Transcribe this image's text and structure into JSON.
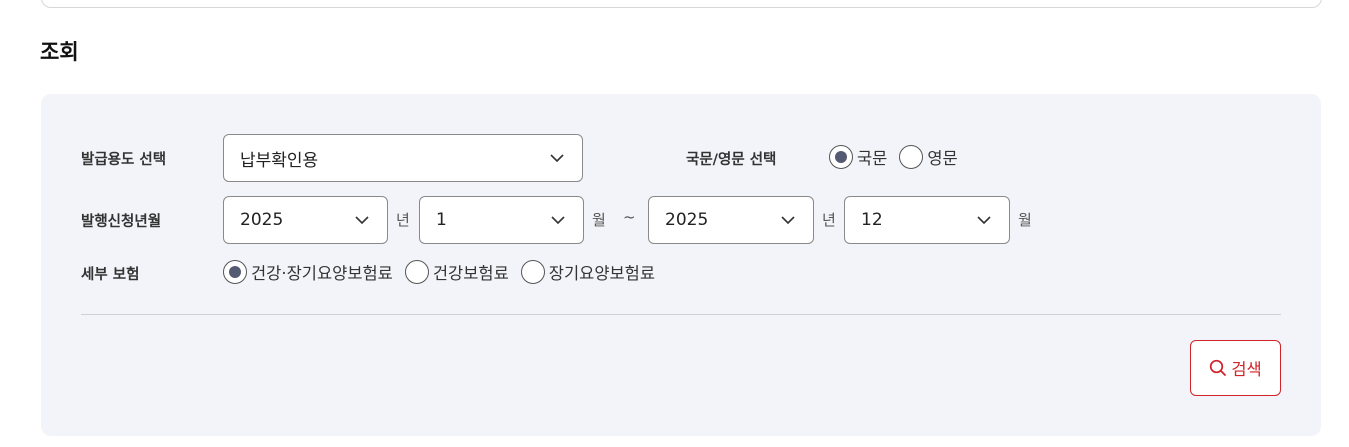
{
  "section_title": "조회",
  "purpose": {
    "label": "발급용도 선택",
    "selected": "납부확인용"
  },
  "language": {
    "label": "국문/영문 선택",
    "options": [
      {
        "label": "국문",
        "checked": true
      },
      {
        "label": "영문",
        "checked": false
      }
    ]
  },
  "period": {
    "label": "발행신청년월",
    "start_year": "2025",
    "start_month": "1",
    "end_year": "2025",
    "end_month": "12",
    "year_unit": "년",
    "month_unit": "월",
    "separator": "~"
  },
  "insurance": {
    "label": "세부 보험",
    "options": [
      {
        "label": "건강·장기요양보험료",
        "checked": true
      },
      {
        "label": "건강보험료",
        "checked": false
      },
      {
        "label": "장기요양보험료",
        "checked": false
      }
    ]
  },
  "search_button": {
    "label": "검색"
  },
  "colors": {
    "panel_bg": "#f3f4f9",
    "accent_red": "#d2232a",
    "radio_fill": "#555a73"
  },
  "icons": {
    "dropdown": "chevron-down-icon",
    "search": "search-icon"
  }
}
